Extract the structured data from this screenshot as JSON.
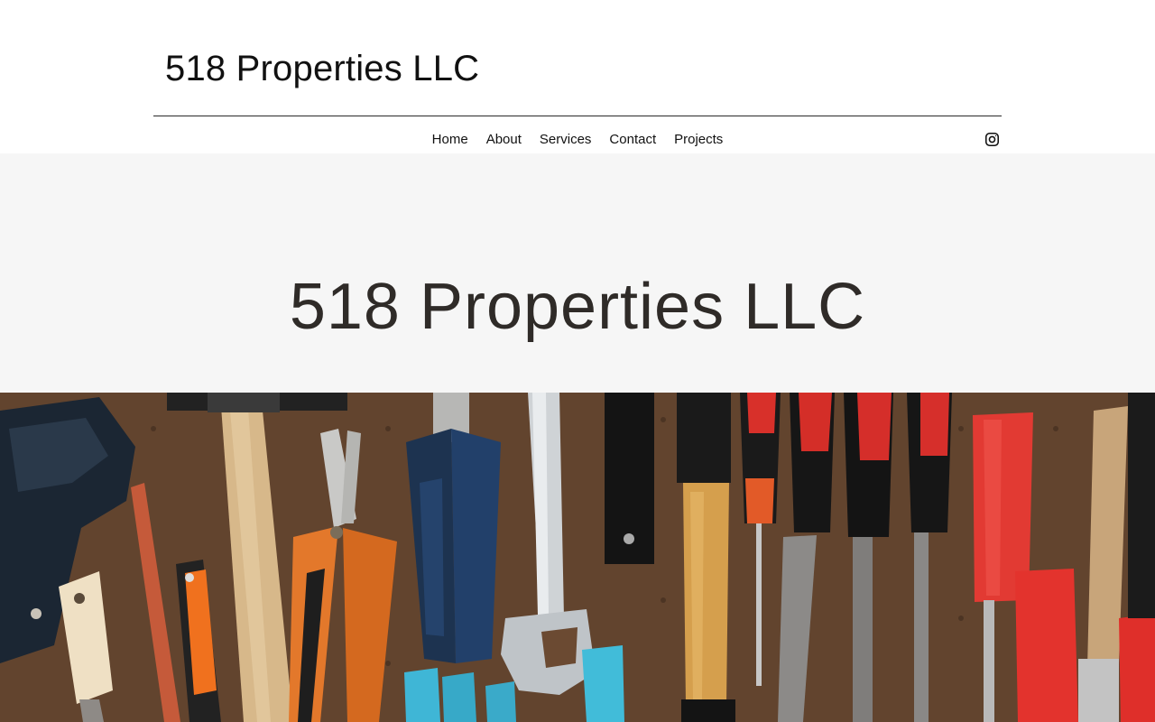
{
  "header": {
    "site_title": "518 Properties LLC",
    "nav": [
      "Home",
      "About",
      "Services",
      "Contact",
      "Projects"
    ],
    "social_icon": "instagram-icon"
  },
  "hero": {
    "title": "518 Properties LLC",
    "band_color": "#f6f6f6",
    "image": "tools-on-pegboard"
  },
  "colors": {
    "text": "#111111",
    "hero_text": "#2f2b28",
    "pegboard": "#6a4a33",
    "accent_red": "#d8302a",
    "accent_blue": "#1f3552"
  }
}
